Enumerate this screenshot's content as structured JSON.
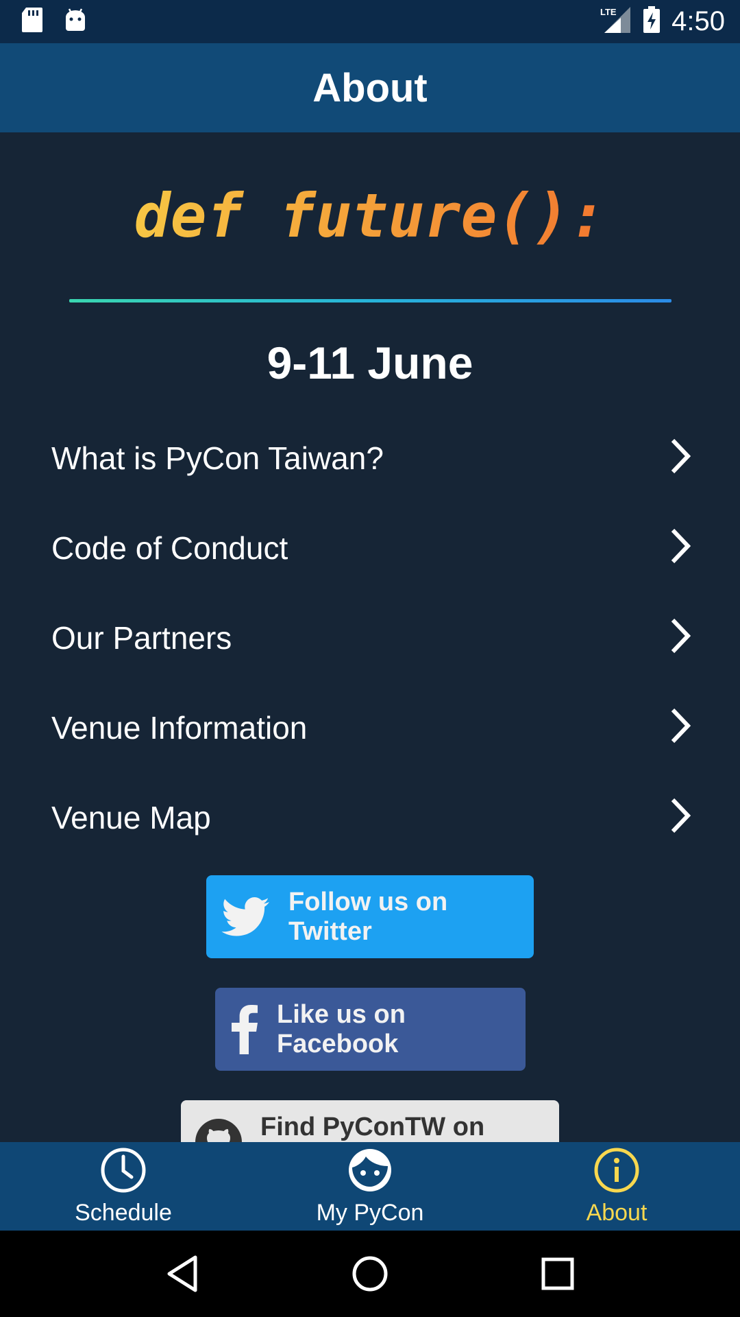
{
  "status_bar": {
    "time": "4:50",
    "network_label": "LTE",
    "icons": [
      "sd-card-icon",
      "android-icon",
      "lte-signal-icon",
      "battery-charging-icon"
    ]
  },
  "app_bar": {
    "title": "About"
  },
  "hero": {
    "slogan": "def future():",
    "date": "9-11 June"
  },
  "menu": {
    "items": [
      {
        "label": "What is PyCon Taiwan?"
      },
      {
        "label": "Code of Conduct"
      },
      {
        "label": "Our Partners"
      },
      {
        "label": "Venue Information"
      },
      {
        "label": "Venue Map"
      }
    ]
  },
  "social": {
    "twitter_label": "Follow us on Twitter",
    "facebook_label": "Like us on Facebook",
    "github_label": "Find PyConTW on Github"
  },
  "bottom_nav": {
    "items": [
      {
        "label": "Schedule",
        "icon": "clock-icon"
      },
      {
        "label": "My PyCon",
        "icon": "face-icon"
      },
      {
        "label": "About",
        "icon": "info-icon",
        "active": true
      }
    ]
  },
  "colors": {
    "background": "#162536",
    "app_bar": "#114a77",
    "bottom_nav": "#0f4775",
    "active_accent": "#f8d84f",
    "twitter": "#1da1f2",
    "facebook": "#3b5998",
    "github": "#e6e6e6"
  }
}
